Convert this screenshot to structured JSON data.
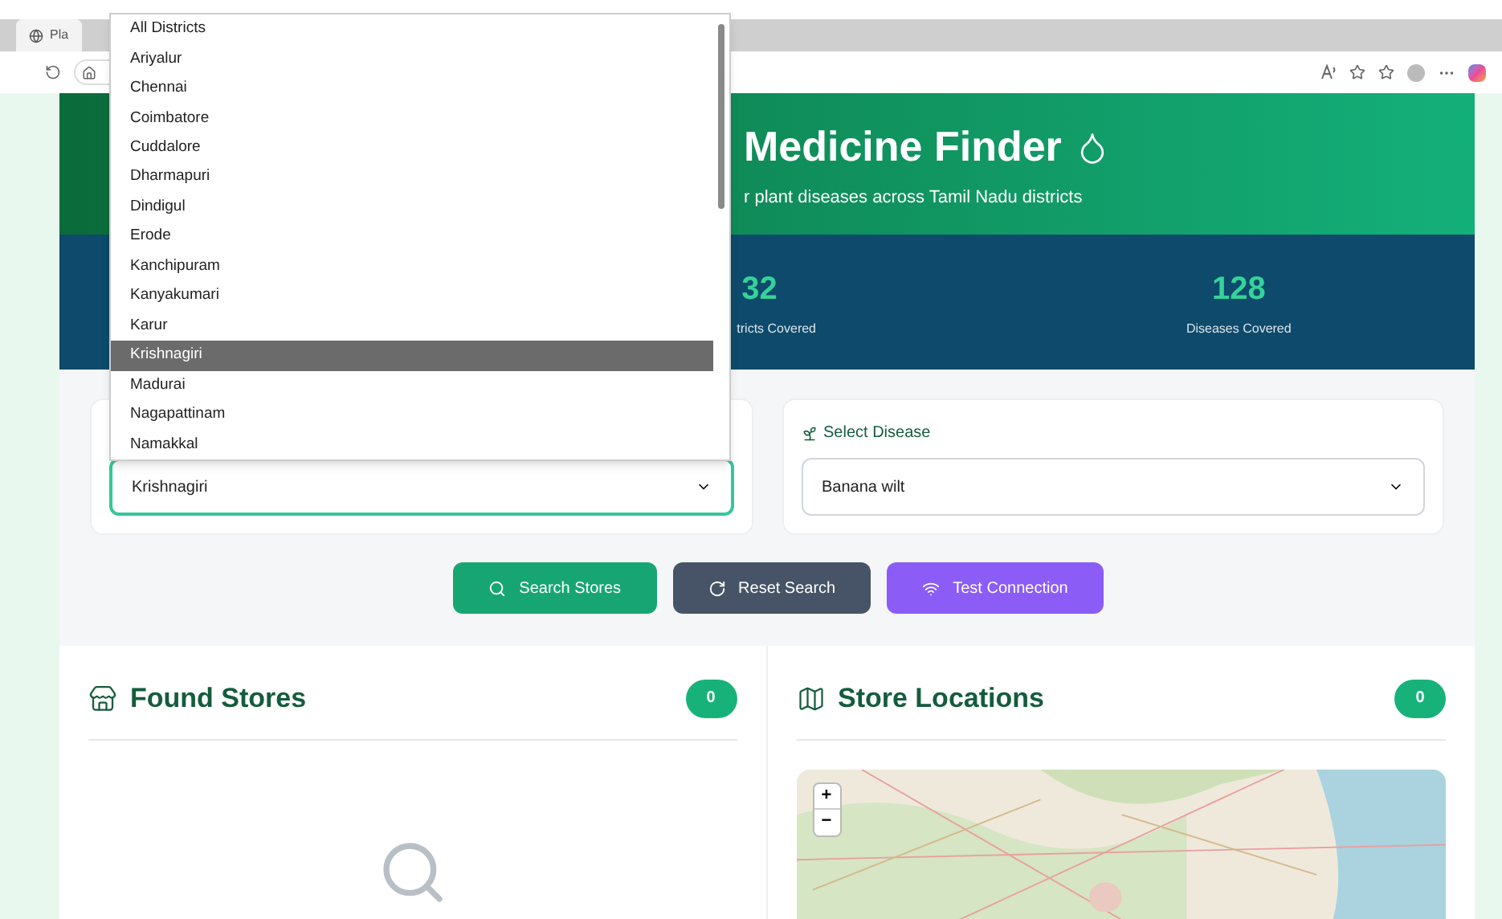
{
  "browser": {
    "tab_title": "Pla"
  },
  "header": {
    "title": "Medicine Finder",
    "subtitle": "r plant diseases across Tamil Nadu districts"
  },
  "stats": [
    {
      "value": "32",
      "label": "tricts Covered"
    },
    {
      "value": "128",
      "label": "Diseases Covered"
    }
  ],
  "district_select": {
    "value": "Krishnagiri",
    "options": [
      {
        "label": "All Districts",
        "selected": false
      },
      {
        "label": "Ariyalur",
        "selected": false
      },
      {
        "label": "Chennai",
        "selected": false
      },
      {
        "label": "Coimbatore",
        "selected": false
      },
      {
        "label": "Cuddalore",
        "selected": false
      },
      {
        "label": "Dharmapuri",
        "selected": false
      },
      {
        "label": "Dindigul",
        "selected": false
      },
      {
        "label": "Erode",
        "selected": false
      },
      {
        "label": "Kanchipuram",
        "selected": false
      },
      {
        "label": "Kanyakumari",
        "selected": false
      },
      {
        "label": "Karur",
        "selected": false
      },
      {
        "label": "Krishnagiri",
        "selected": true
      },
      {
        "label": "Madurai",
        "selected": false
      },
      {
        "label": "Nagapattinam",
        "selected": false
      },
      {
        "label": "Namakkal",
        "selected": false
      }
    ]
  },
  "disease_select": {
    "label": "Select Disease",
    "value": "Banana wilt"
  },
  "buttons": [
    {
      "label": "Search Stores",
      "kind": "search"
    },
    {
      "label": "Reset Search",
      "kind": "reset"
    },
    {
      "label": "Test Connection",
      "kind": "test"
    }
  ],
  "found_stores": {
    "title": "Found Stores",
    "count": "0"
  },
  "store_locations": {
    "title": "Store Locations",
    "count": "0",
    "zoom_in": "+",
    "zoom_out": "−"
  }
}
